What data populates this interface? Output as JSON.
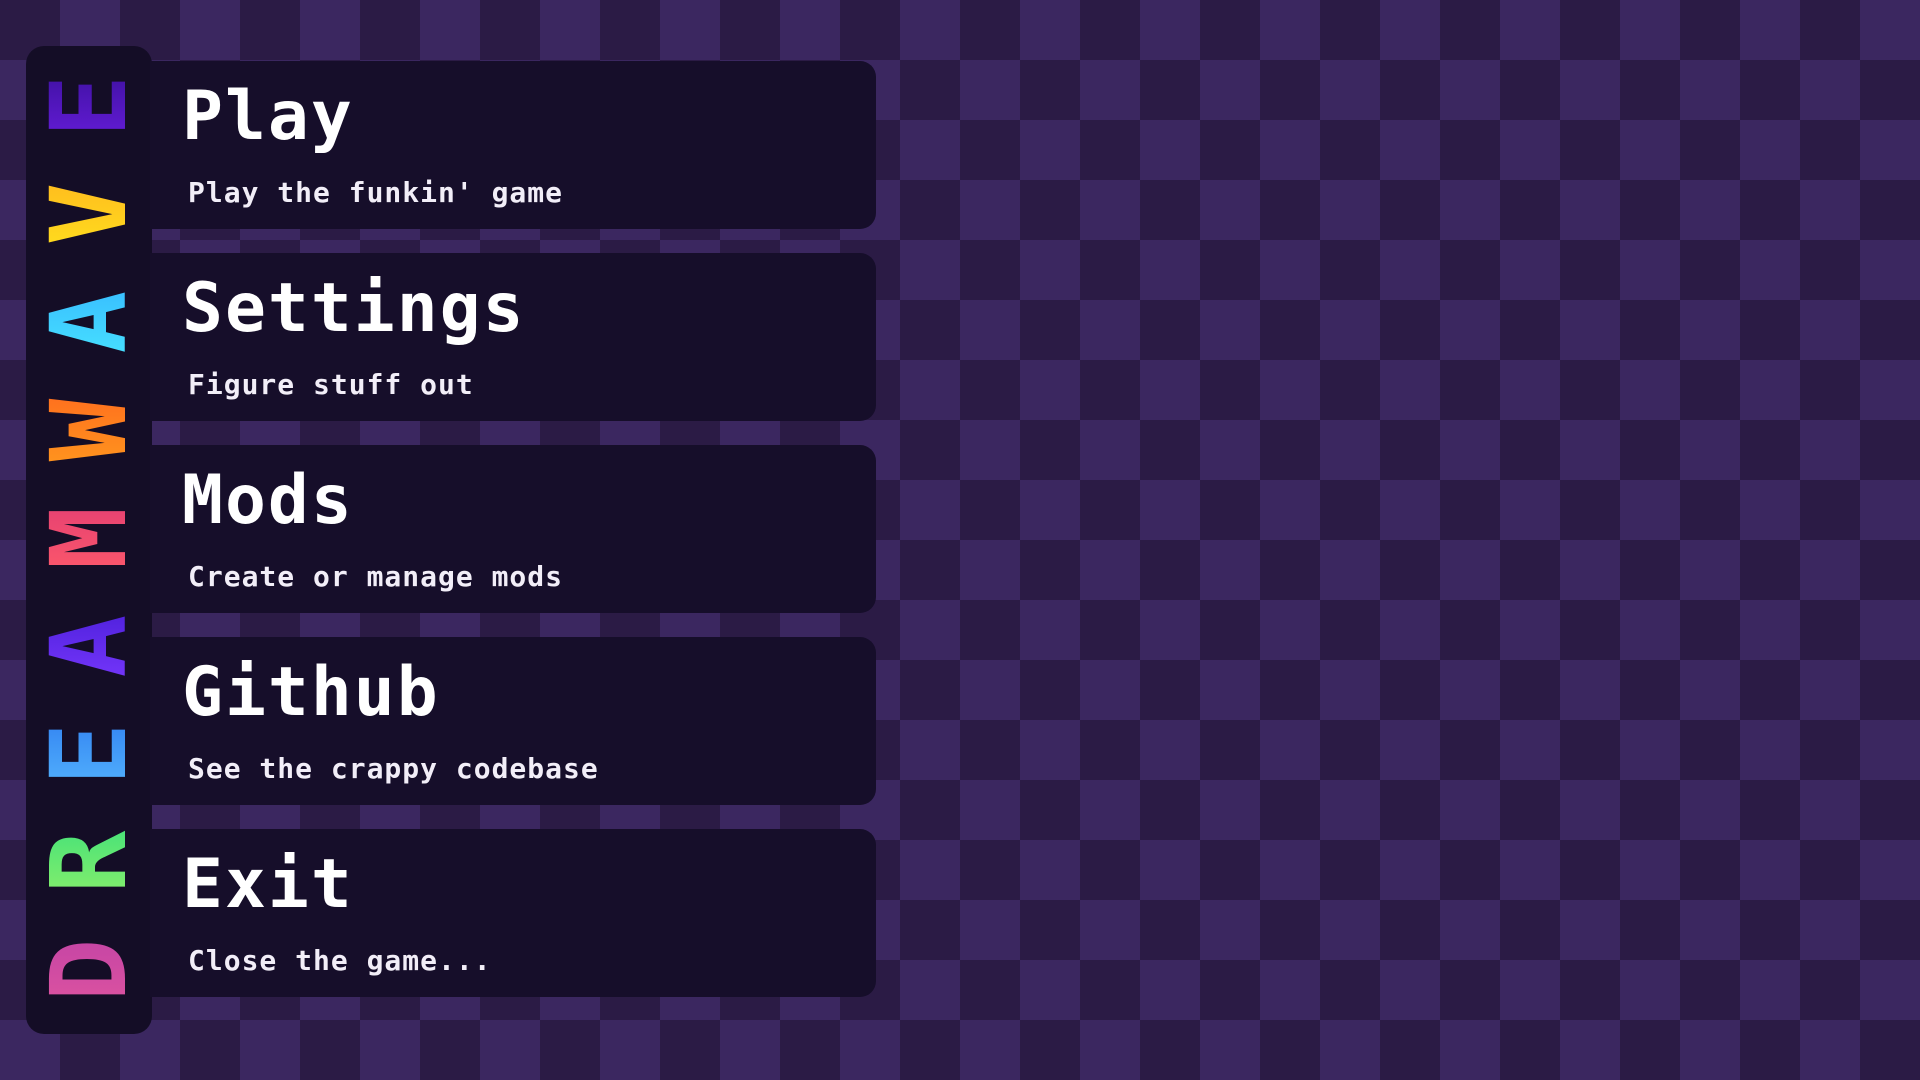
{
  "logo": {
    "text": "DREAMWAVE",
    "letters": [
      {
        "char": "D",
        "colors": [
          "#e0559f",
          "#c042a6"
        ]
      },
      {
        "char": "R",
        "colors": [
          "#8ff06a",
          "#3ee07a"
        ]
      },
      {
        "char": "E",
        "colors": [
          "#58b9ff",
          "#2e7df0"
        ]
      },
      {
        "char": "A",
        "colors": [
          "#7a39ff",
          "#4a1ed8"
        ]
      },
      {
        "char": "M",
        "colors": [
          "#ff5b6a",
          "#e23d73"
        ]
      },
      {
        "char": "W",
        "colors": [
          "#ff9a1e",
          "#ff6a1e"
        ]
      },
      {
        "char": "A",
        "colors": [
          "#49e6ff",
          "#36b8ff"
        ]
      },
      {
        "char": "V",
        "colors": [
          "#ffe21e",
          "#ffb61e"
        ]
      },
      {
        "char": "E",
        "colors": [
          "#6a1ee0",
          "#3a0f9a"
        ]
      }
    ]
  },
  "menu": {
    "items": [
      {
        "title": "Play",
        "desc": "Play the funkin' game"
      },
      {
        "title": "Settings",
        "desc": "Figure stuff out"
      },
      {
        "title": "Mods",
        "desc": "Create or manage mods"
      },
      {
        "title": "Github",
        "desc": "See the crappy codebase"
      },
      {
        "title": "Exit",
        "desc": "Close the game..."
      }
    ]
  },
  "colors": {
    "background_dark": "#2b1b45",
    "background_light": "#3b2760",
    "panel": "#160e2a",
    "text": "#ffffff"
  }
}
